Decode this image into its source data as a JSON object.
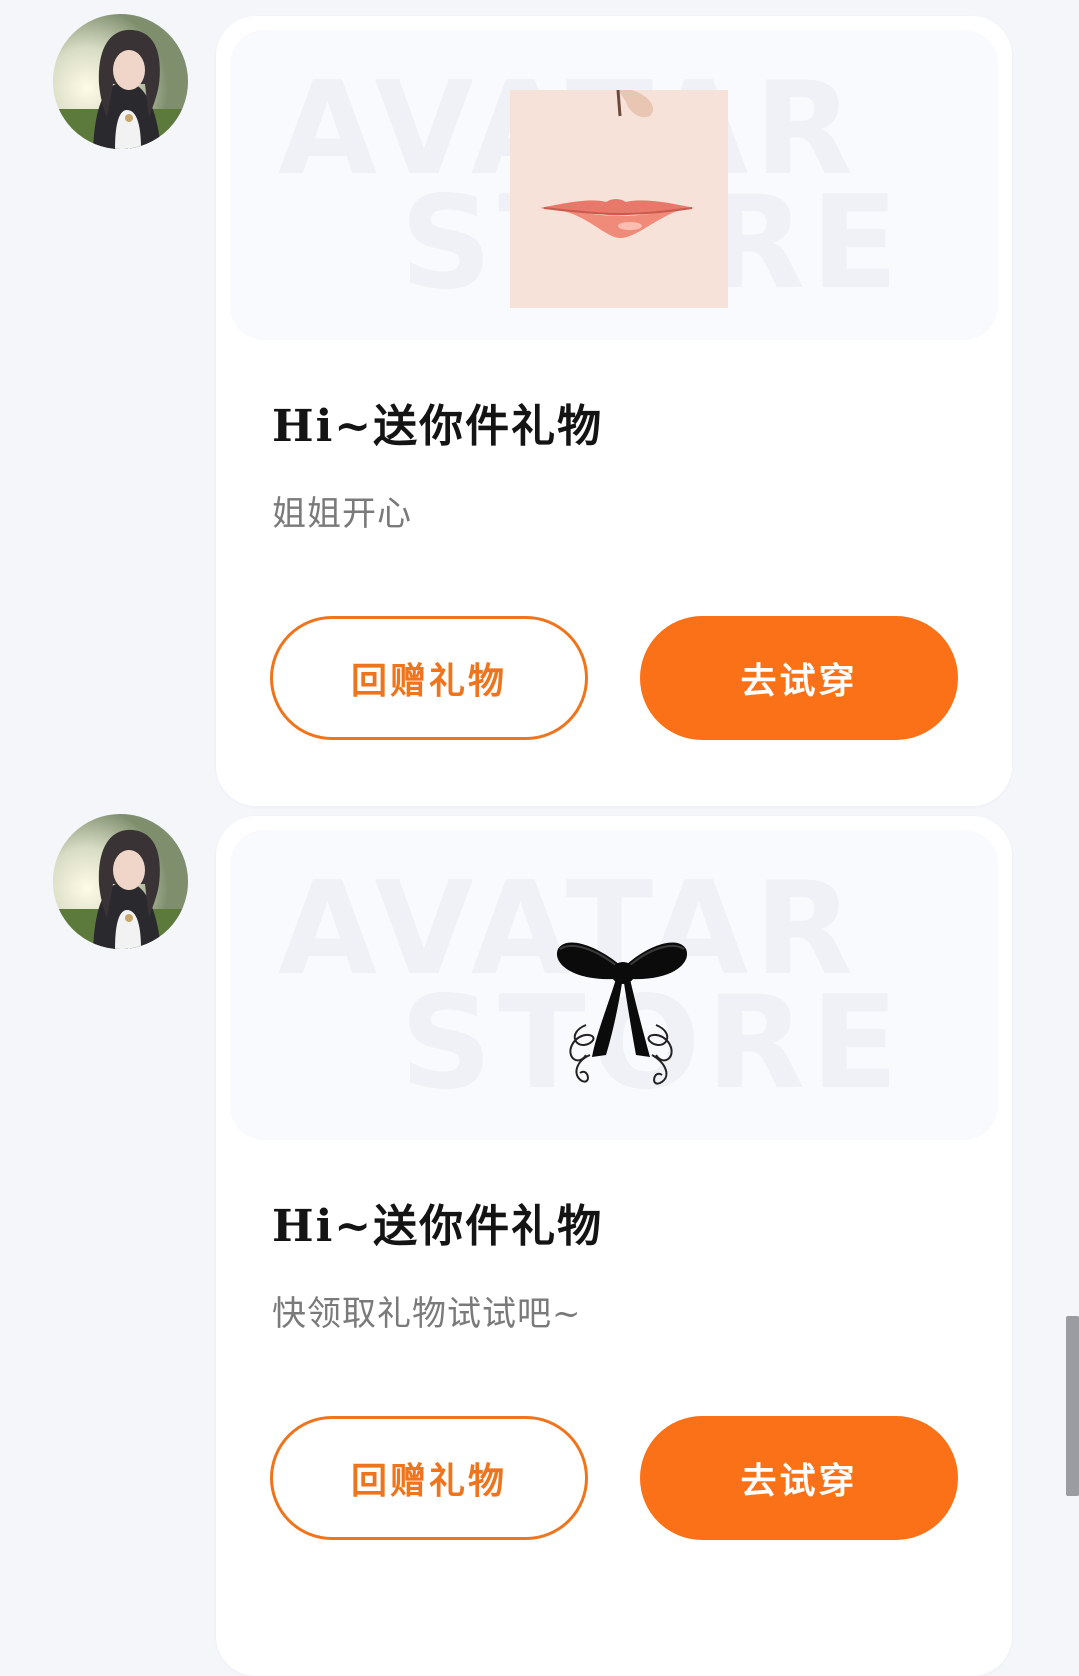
{
  "colors": {
    "accent": "#fa7118",
    "accent_outline": "#f0741b",
    "page_background": "#f4f6fa",
    "card_background": "#ffffff"
  },
  "banner_watermark": {
    "line1": "AVATAR",
    "line2": "STORE"
  },
  "messages": [
    {
      "avatar_icon": "user-avatar-photo",
      "gift_icon": "lips-gift-icon",
      "title": "Hi~送你件礼物",
      "subtitle": "姐姐开心",
      "return_gift_label": "回赠礼物",
      "try_on_label": "去试穿"
    },
    {
      "avatar_icon": "user-avatar-photo",
      "gift_icon": "hair-bow-gift-icon",
      "title": "Hi~送你件礼物",
      "subtitle": "快领取礼物试试吧~",
      "return_gift_label": "回赠礼物",
      "try_on_label": "去试穿"
    }
  ]
}
